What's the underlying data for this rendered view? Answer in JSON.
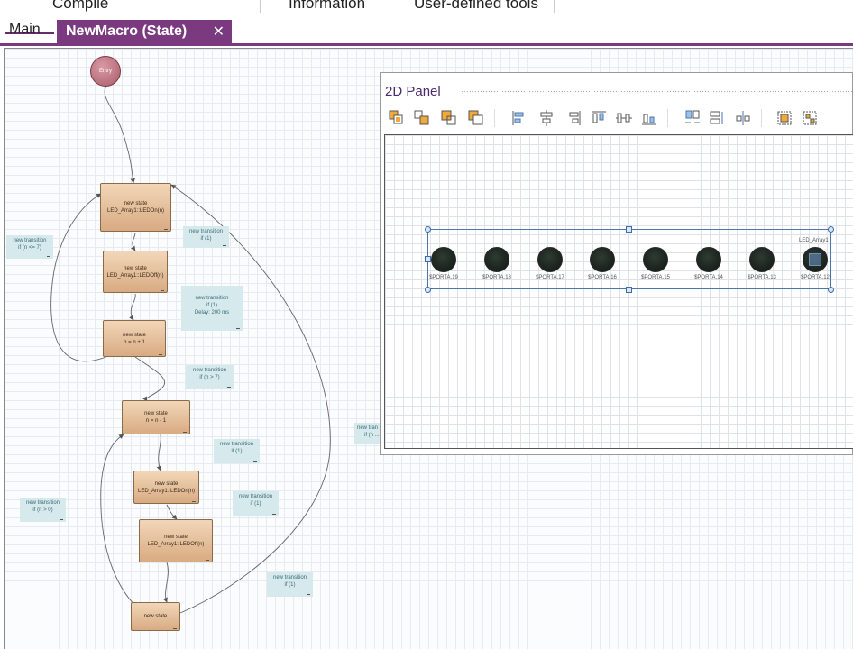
{
  "menu": {
    "compile": "Compile",
    "information": "Information",
    "user_tools": "User-defined tools"
  },
  "tabs": {
    "main": "Main",
    "active": "NewMacro (State)",
    "close": "✕"
  },
  "diagram": {
    "entry": "Entry",
    "states": [
      {
        "title": "new state",
        "action": "LED_Array1::LEDOn(n)"
      },
      {
        "title": "new state",
        "action": "LED_Array1::LEDOff(n)"
      },
      {
        "title": "new state",
        "action": "n = n + 1"
      },
      {
        "title": "new state",
        "action": "n = n - 1"
      },
      {
        "title": "new state",
        "action": "LED_Array1::LEDOn(n)"
      },
      {
        "title": "new state",
        "action": "LED_Array1::LEDOff(n)"
      },
      {
        "title": "new state",
        "action": ""
      }
    ],
    "transitions": [
      {
        "title": "new transition",
        "cond": "if (n <= 7)",
        "extra": ""
      },
      {
        "title": "new transition",
        "cond": "if (1)",
        "extra": ""
      },
      {
        "title": "new transition",
        "cond": "if (1)",
        "extra": "Delay: 200 ms"
      },
      {
        "title": "new transition",
        "cond": "if (n > 7)",
        "extra": ""
      },
      {
        "title": "new tran",
        "cond": "if (n ...",
        "extra": ""
      },
      {
        "title": "new transition",
        "cond": "if (1)",
        "extra": ""
      },
      {
        "title": "new transition",
        "cond": "if (n > 0)",
        "extra": ""
      },
      {
        "title": "new transition",
        "cond": "if (1)",
        "extra": ""
      },
      {
        "title": "new transition",
        "cond": "if (1)",
        "extra": ""
      }
    ]
  },
  "panel": {
    "title": "2D Panel",
    "array_name": "LED_Array1",
    "leds": [
      "$PORTA.19",
      "$PORTA.18",
      "$PORTA.17",
      "$PORTA.16",
      "$PORTA.15",
      "$PORTA.14",
      "$PORTA.13",
      "$PORTA.12"
    ]
  },
  "colors": {
    "accent": "#7b3a7f",
    "state_fill": "#dcb38c",
    "transition_fill": "#d6e9ec",
    "led_off": "#1a241d"
  }
}
